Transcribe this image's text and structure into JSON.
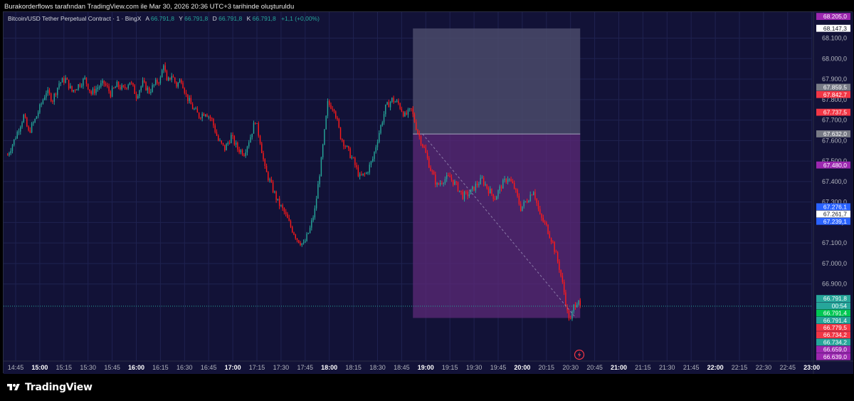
{
  "caption": "Burakorderflows tarafından TradingView.com ile Mar 30, 2026 20:36 UTC+3 tarihinde oluşturuldu",
  "brand": "TradingView",
  "legend": {
    "symbol": "Bitcoin/USD Tether Perpetual Contract · 1 · BingX",
    "a_label": "A",
    "a_value": "66.791,8",
    "y_label": "Y",
    "y_value": "66.791,8",
    "d_label": "D",
    "d_value": "66.791,8",
    "k_label": "K",
    "k_value": "66.791,8",
    "change": "+1,1 (+0,00%)"
  },
  "colors": {
    "background": "#121237",
    "up": "#26a69a",
    "down": "#ff1a1a",
    "grid": "#1f2250",
    "axis_text": "#b2b5be",
    "stop_zone": "#4a4a6a",
    "target_zone": "#5c2a78",
    "last_price_line": "#26a69a",
    "legend_value": "#26a69a"
  },
  "chart_data": {
    "type": "candlestick",
    "interval": "1 minute",
    "x_time_ticks": [
      "14:45",
      "15:00",
      "15:15",
      "15:30",
      "15:45",
      "16:00",
      "16:15",
      "16:30",
      "16:45",
      "17:00",
      "17:15",
      "17:30",
      "17:45",
      "18:00",
      "18:15",
      "18:30",
      "18:45",
      "19:00",
      "19:15",
      "19:30",
      "19:45",
      "20:00",
      "20:15",
      "20:30",
      "20:45",
      "21:00",
      "21:15",
      "21:30",
      "21:45",
      "22:00",
      "22:15",
      "22:30",
      "22:45",
      "23:00"
    ],
    "x_bold_ticks": [
      "15:00",
      "16:00",
      "17:00",
      "18:00",
      "19:00",
      "20:00",
      "21:00",
      "22:00",
      "23:00"
    ],
    "y_ticks": [
      "68.100,0",
      "68.000,0",
      "67.900,0",
      "67.800,0",
      "67.700,0",
      "67.600,0",
      "67.500,0",
      "67.400,0",
      "67.300,0",
      "67.200,0",
      "67.100,0",
      "67.000,0",
      "66.900,0"
    ],
    "y_range": [
      66600,
      68220
    ],
    "close_path": [
      [
        "14:40",
        67530
      ],
      [
        "14:44",
        67600
      ],
      [
        "14:47",
        67660
      ],
      [
        "14:50",
        67720
      ],
      [
        "14:53",
        67640
      ],
      [
        "14:57",
        67700
      ],
      [
        "15:00",
        67760
      ],
      [
        "15:04",
        67840
      ],
      [
        "15:08",
        67800
      ],
      [
        "15:12",
        67880
      ],
      [
        "15:16",
        67900
      ],
      [
        "15:20",
        67840
      ],
      [
        "15:24",
        67870
      ],
      [
        "15:28",
        67900
      ],
      [
        "15:32",
        67830
      ],
      [
        "15:36",
        67860
      ],
      [
        "15:40",
        67880
      ],
      [
        "15:44",
        67830
      ],
      [
        "15:48",
        67870
      ],
      [
        "15:52",
        67850
      ],
      [
        "15:56",
        67890
      ],
      [
        "16:00",
        67820
      ],
      [
        "16:04",
        67880
      ],
      [
        "16:08",
        67840
      ],
      [
        "16:12",
        67880
      ],
      [
        "16:15",
        67900
      ],
      [
        "16:17",
        67980
      ],
      [
        "16:19",
        67880
      ],
      [
        "16:22",
        67920
      ],
      [
        "16:25",
        67870
      ],
      [
        "16:28",
        67900
      ],
      [
        "16:31",
        67820
      ],
      [
        "16:35",
        67760
      ],
      [
        "16:39",
        67720
      ],
      [
        "16:43",
        67740
      ],
      [
        "16:47",
        67700
      ],
      [
        "16:51",
        67600
      ],
      [
        "16:55",
        67560
      ],
      [
        "16:59",
        67620
      ],
      [
        "17:03",
        67560
      ],
      [
        "17:07",
        67540
      ],
      [
        "17:11",
        67620
      ],
      [
        "17:14",
        67700
      ],
      [
        "17:17",
        67600
      ],
      [
        "17:20",
        67460
      ],
      [
        "17:24",
        67380
      ],
      [
        "17:28",
        67300
      ],
      [
        "17:32",
        67250
      ],
      [
        "17:36",
        67180
      ],
      [
        "17:40",
        67120
      ],
      [
        "17:44",
        67090
      ],
      [
        "17:48",
        67170
      ],
      [
        "17:51",
        67260
      ],
      [
        "17:55",
        67500
      ],
      [
        "17:59",
        67780
      ],
      [
        "18:03",
        67760
      ],
      [
        "18:07",
        67620
      ],
      [
        "18:11",
        67560
      ],
      [
        "18:15",
        67500
      ],
      [
        "18:19",
        67420
      ],
      [
        "18:23",
        67440
      ],
      [
        "18:27",
        67510
      ],
      [
        "18:31",
        67640
      ],
      [
        "18:35",
        67760
      ],
      [
        "18:39",
        67800
      ],
      [
        "18:43",
        67780
      ],
      [
        "18:47",
        67720
      ],
      [
        "18:51",
        67750
      ],
      [
        "18:55",
        67640
      ],
      [
        "18:59",
        67560
      ],
      [
        "19:03",
        67460
      ],
      [
        "19:07",
        67380
      ],
      [
        "19:11",
        67410
      ],
      [
        "19:15",
        67420
      ],
      [
        "19:19",
        67380
      ],
      [
        "19:23",
        67330
      ],
      [
        "19:27",
        67340
      ],
      [
        "19:31",
        67380
      ],
      [
        "19:35",
        67410
      ],
      [
        "19:39",
        67360
      ],
      [
        "19:43",
        67320
      ],
      [
        "19:47",
        67380
      ],
      [
        "19:51",
        67420
      ],
      [
        "19:55",
        67370
      ],
      [
        "19:59",
        67270
      ],
      [
        "20:03",
        67310
      ],
      [
        "20:07",
        67360
      ],
      [
        "20:11",
        67230
      ],
      [
        "20:15",
        67180
      ],
      [
        "20:19",
        67100
      ],
      [
        "20:23",
        66980
      ],
      [
        "20:26",
        66860
      ],
      [
        "20:28",
        66760
      ],
      [
        "20:30",
        66720
      ],
      [
        "20:32",
        66790
      ],
      [
        "20:35",
        66830
      ],
      [
        "20:36",
        66791.8
      ]
    ],
    "last_price": 66791.8,
    "position_tool": {
      "entry": 67632.0,
      "stop": 68147.3,
      "target": 66734.2,
      "start_time": "18:52",
      "end_time": "20:36"
    },
    "price_labels": [
      {
        "text": "68.205,0",
        "value": 68205,
        "color": "#9c27b0"
      },
      {
        "text": "68.147,3",
        "value": 68147.3,
        "color": "#ffffff"
      },
      {
        "text": "67.859,5",
        "value": 67859.5,
        "color": "#787b86"
      },
      {
        "text": "67.842,7",
        "value": 67842.7,
        "color": "#f23645"
      },
      {
        "text": "67.737,5",
        "value": 67737.5,
        "color": "#f23645"
      },
      {
        "text": "67.632,0",
        "value": 67632,
        "color": "#787b86"
      },
      {
        "text": "67.480,0",
        "value": 67480,
        "color": "#9c27b0"
      },
      {
        "text": "67.276,1",
        "value": 67276.1,
        "color": "#2962ff"
      },
      {
        "text": "67.261,7",
        "value": 67261.7,
        "color": "#ffffff"
      },
      {
        "text": "67.239,1",
        "value": 67239.1,
        "color": "#2962ff"
      },
      {
        "text": "66.791,8",
        "value": 66791.8,
        "color": "#26a69a"
      },
      {
        "text": "00:54",
        "value": 66791.8,
        "color": "#26a69a"
      },
      {
        "text": "66.791,4",
        "value": 66791.4,
        "color": "#00c853"
      },
      {
        "text": "66.791,4",
        "value": 66791.4,
        "color": "#26a69a"
      },
      {
        "text": "66.779,5",
        "value": 66779.5,
        "color": "#f23645"
      },
      {
        "text": "66.734,2",
        "value": 66734.2,
        "color": "#f23645"
      },
      {
        "text": "66.734,2",
        "value": 66734.2,
        "color": "#26a69a"
      },
      {
        "text": "66.659,0",
        "value": 66659,
        "color": "#9c27b0"
      },
      {
        "text": "66.639,0",
        "value": 66639,
        "color": "#9c27b0"
      }
    ]
  }
}
